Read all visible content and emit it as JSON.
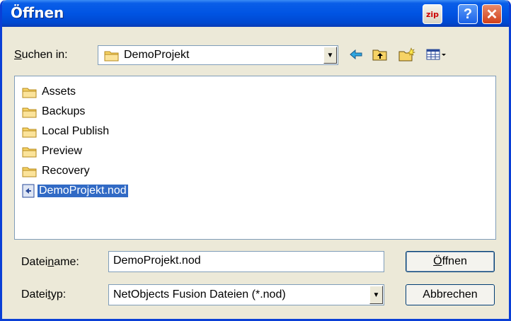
{
  "window": {
    "title": "Öffnen"
  },
  "titlebar": {
    "zip_label": "zip",
    "help_label": "?",
    "close_label": "✕"
  },
  "lookin": {
    "label_prefix": "S",
    "label_rest": "uchen in:",
    "value": "DemoProjekt"
  },
  "files": [
    {
      "name": "Assets",
      "type": "folder"
    },
    {
      "name": "Backups",
      "type": "folder"
    },
    {
      "name": "Local Publish",
      "type": "folder"
    },
    {
      "name": "Preview",
      "type": "folder"
    },
    {
      "name": "Recovery",
      "type": "folder"
    },
    {
      "name": "DemoProjekt.nod",
      "type": "file",
      "selected": true
    }
  ],
  "filename": {
    "label_pre": "Datei",
    "label_u": "n",
    "label_post": "ame:",
    "value": "DemoProjekt.nod"
  },
  "filetype": {
    "label_pre": "Datei",
    "label_u": "t",
    "label_post": "yp:",
    "value": "NetObjects Fusion Dateien (*.nod)"
  },
  "buttons": {
    "open_u": "Ö",
    "open_rest": "ffnen",
    "cancel": "Abbrechen"
  },
  "colors": {
    "titlebar": "#0054e3",
    "face": "#ece9d8",
    "selection": "#316ac5",
    "folder": "#f6d365"
  }
}
